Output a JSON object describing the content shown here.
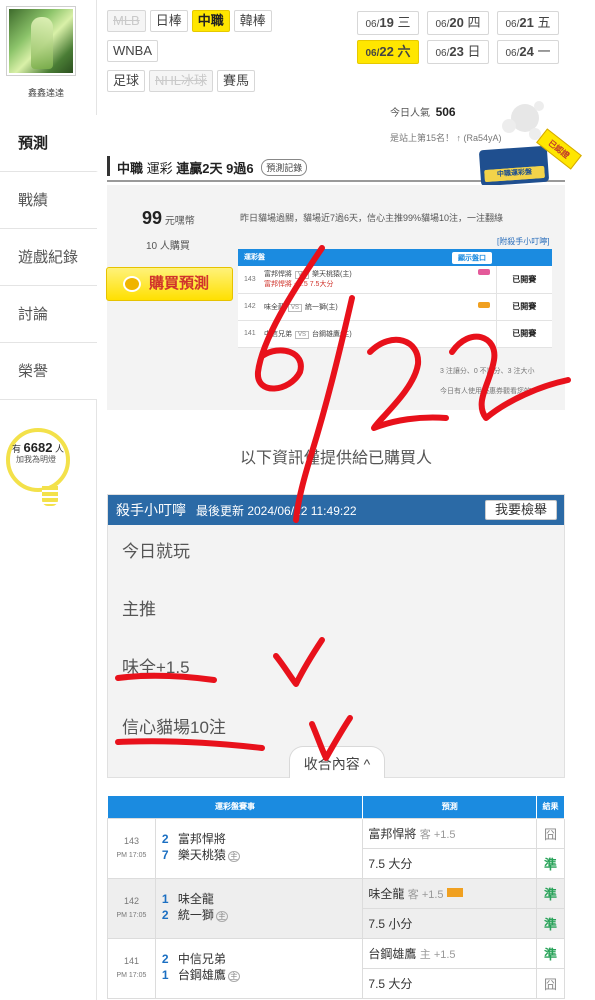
{
  "sidebar": {
    "username": "鑫鑫達達",
    "items": [
      {
        "label": "預測",
        "active": true
      },
      {
        "label": "戰績"
      },
      {
        "label": "遊戲紀錄"
      },
      {
        "label": "討論"
      },
      {
        "label": "榮譽"
      }
    ],
    "fans": {
      "prefix": "有",
      "count": "6682",
      "suffix": "人",
      "caption": "加我為明燈"
    }
  },
  "leagues": {
    "row1": [
      "MLB",
      "日棒",
      "中職",
      "韓棒"
    ],
    "row2": [
      "WNBA"
    ],
    "row3": [
      "足球",
      "NHL冰球",
      "賽馬"
    ],
    "active": "中職",
    "disabled": [
      "MLB",
      "NHL冰球"
    ]
  },
  "dates": [
    {
      "md": "06/",
      "d": "19",
      "w": "三"
    },
    {
      "md": "06/",
      "d": "20",
      "w": "四"
    },
    {
      "md": "06/",
      "d": "21",
      "w": "五"
    },
    {
      "md": "06/",
      "d": "22",
      "w": "六",
      "active": true
    },
    {
      "md": "06/",
      "d": "23",
      "w": "日"
    },
    {
      "md": "06/",
      "d": "24",
      "w": "一"
    }
  ],
  "popularity": {
    "label": "今日人氣",
    "value": "506"
  },
  "rank_text": "是站上第15名！ ↑ (Ra54yA)",
  "title": {
    "league": "中職",
    "category": "運彩",
    "streak": "連贏2天",
    "record": "9過6",
    "record_button": "預測記錄"
  },
  "badge": {
    "main": "殺手",
    "sub": "中職運彩盤",
    "ribbon": "已認證"
  },
  "purchase": {
    "price": "99",
    "price_unit": "元嘿幣",
    "buyers": "10",
    "buyers_unit": "人購買",
    "button": "購買預測",
    "description": "昨日貓場過關，貓場近7過6天，信心主推99%貓場10注，一注翻綠",
    "tip_link": "[附殺手小叮嚀]"
  },
  "mini_table": {
    "header": "運彩盤",
    "show_button": "顯示盤口",
    "rows": [
      {
        "num": "143",
        "away": "富邦悍將",
        "home": "樂天桃猿(主)",
        "pick": "富邦悍將 +1.5 7.5大分",
        "status": "已開賽"
      },
      {
        "num": "142",
        "away": "味全龍",
        "home": "統一獅(主)",
        "pick": "",
        "status": "已開賽"
      },
      {
        "num": "141",
        "away": "中信兄弟",
        "home": "台鋼雄鷹(主)",
        "pick": "",
        "status": "已開賽"
      }
    ],
    "vs": "VS",
    "note1": "3 注讓分、0 不讓分、3 注大小",
    "note2": "今日有人使用優惠券觀看您的"
  },
  "info_text": "以下資訊僅提供給已購買人",
  "tips": {
    "title": "殺手小叮嚀",
    "updated": "最後更新 2024/06/22 11:49:22",
    "report_button": "我要檢舉",
    "lines": [
      "今日就玩",
      "主推",
      "味全+1.5",
      "信心貓場10注"
    ],
    "collapse_button": "收合內容 ^"
  },
  "results": {
    "headers": [
      "運彩盤賽事",
      "預測",
      "結果"
    ],
    "games": [
      {
        "id": "143",
        "time": "PM 17:05",
        "away_score": "2",
        "away": "富邦悍將",
        "home_score": "7",
        "home": "樂天桃猿",
        "pick1": "富邦悍將",
        "pick1_side": "客 +1.5",
        "res1": "囧",
        "pick2": "7.5 大分",
        "res2": "準"
      },
      {
        "id": "142",
        "time": "PM 17:05",
        "away_score": "1",
        "away": "味全龍",
        "home_score": "2",
        "home": "統一獅",
        "pick1": "味全龍",
        "pick1_side": "客 +1.5",
        "res1": "準",
        "pick2": "7.5 小分",
        "res2": "準"
      },
      {
        "id": "141",
        "time": "PM 17:05",
        "away_score": "2",
        "away": "中信兄弟",
        "home_score": "1",
        "home": "台鋼雄鷹",
        "pick1": "台鋼雄鷹",
        "pick1_side": "主 +1.5",
        "res1": "準",
        "pick2": "7.5 大分",
        "res2": "囧"
      }
    ],
    "home_mark": "主"
  },
  "handwriting": {
    "text": "6/22",
    "color": "#e8111b"
  }
}
